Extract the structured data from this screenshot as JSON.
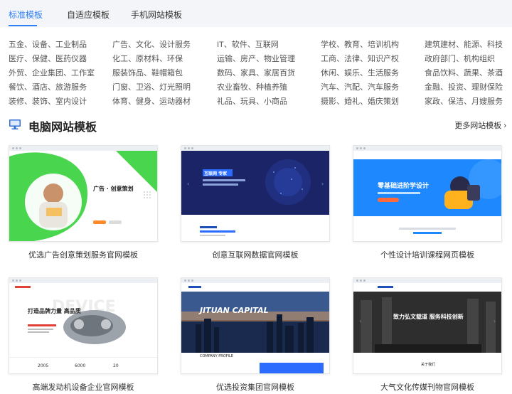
{
  "tabs": [
    {
      "label": "标准模板",
      "active": true
    },
    {
      "label": "自适应模板",
      "active": false
    },
    {
      "label": "手机网站模板",
      "active": false
    }
  ],
  "categories": [
    [
      "五金、设备、工业制品",
      "广告、文化、设计服务",
      "IT、软件、互联网",
      "学校、教育、培训机构",
      "建筑建材、能源、科技"
    ],
    [
      "医疗、保健、医药仪器",
      "化工、原材料、环保",
      "运输、房产、物业管理",
      "工商、法律、知识产权",
      "政府部门、机构组织"
    ],
    [
      "外贸、企业集团、工作室",
      "服装饰品、鞋帽箱包",
      "数码、家具、家居百货",
      "休闲、娱乐、生活服务",
      "食品饮料、蔬果、茶酒"
    ],
    [
      "餐饮、酒店、旅游服务",
      "门窗、卫浴、灯光照明",
      "农业畜牧、种植养殖",
      "汽车、汽配、汽车服务",
      "金融、投资、理财保险"
    ],
    [
      "装修、装饰、室内设计",
      "体育、健身、运动器材",
      "礼品、玩具、小商品",
      "摄影、婚礼、婚庆策划",
      "家政、保洁、月嫂服务"
    ]
  ],
  "section": {
    "title": "电脑网站模板",
    "more_label": "更多网站模板 ›",
    "icon": "monitor-icon"
  },
  "templates": [
    {
      "caption": "优选广告创意策划服务官网模板",
      "thumb_text": "广告 · 创意策划",
      "accent": "#46d64b"
    },
    {
      "caption": "创意互联网数据官网模板",
      "thumb_text": "互联网 专家",
      "accent": "#1c2a6e"
    },
    {
      "caption": "个性设计培训课程网页模板",
      "thumb_text": "零基础进阶学设计",
      "accent": "#1e88ff"
    },
    {
      "caption": "高端发动机设备企业官网模板",
      "thumb_text": "打造品牌力量 高品质",
      "accent": "#e2413a",
      "stats": [
        "2005",
        "6000",
        "20"
      ]
    },
    {
      "caption": "优选投资集团官网模板",
      "thumb_text": "JITUAN CAPITAL",
      "accent": "#1f4fb8",
      "sub_text": "COMPANY PROFILE"
    },
    {
      "caption": "大气文化传媒刊物官网模板",
      "thumb_text": "致力弘文载道 服务科技创新",
      "accent": "#303030",
      "sub_text": "关于我们"
    }
  ]
}
